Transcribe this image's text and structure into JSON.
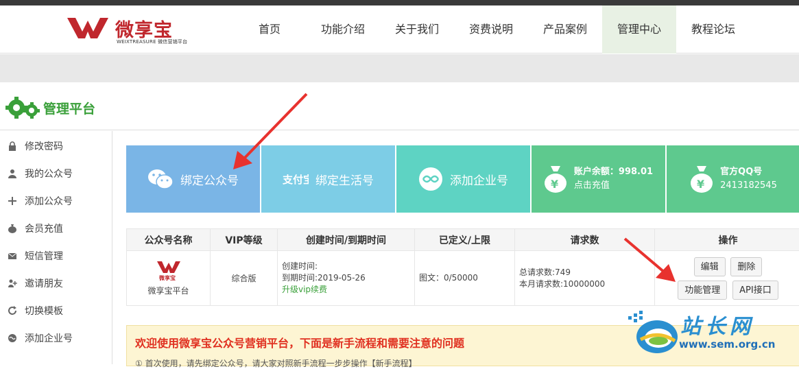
{
  "header": {
    "logo_text": "微享宝",
    "logo_sub": "WEIXTREASURE 微信营销平台",
    "nav": [
      "首页",
      "功能介绍",
      "关于我们",
      "资费说明",
      "产品案例",
      "管理中心",
      "教程论坛"
    ],
    "active_nav": "管理中心"
  },
  "platform": {
    "title": "管理平台"
  },
  "sidebar": {
    "items": [
      {
        "label": "修改密码",
        "icon": "lock-icon"
      },
      {
        "label": "我的公众号",
        "icon": "user-icon"
      },
      {
        "label": "添加公众号",
        "icon": "plus-icon"
      },
      {
        "label": "会员充值",
        "icon": "money-bag-icon"
      },
      {
        "label": "短信管理",
        "icon": "envelope-icon"
      },
      {
        "label": "邀请朋友",
        "icon": "invite-icon"
      },
      {
        "label": "切换模板",
        "icon": "refresh-icon"
      },
      {
        "label": "添加企业号",
        "icon": "enterprise-icon"
      }
    ]
  },
  "cards": {
    "bind_wechat": "绑定公众号",
    "bind_life": "绑定生活号",
    "add_enterprise": "添加企业号",
    "balance_label": "账户余额：998.01",
    "recharge": "点击充值",
    "qq_label": "官方QQ号",
    "qq_number": "2413182545",
    "colors": {
      "wechat": "#7ab5e6",
      "life": "#7dcde6",
      "enterprise": "#5ed3c3",
      "account": "#5ec98e"
    }
  },
  "table": {
    "headers": [
      "公众号名称",
      "VIP等级",
      "创建时间/到期时间",
      "已定义/上限",
      "请求数",
      "操作"
    ],
    "row": {
      "name": "微享宝平台",
      "logo_text": "微享宝",
      "vip": "综合版",
      "created": "创建时间:",
      "expires": "到期时间:2019-05-26",
      "upgrade": "升级vip续费",
      "defined": "图文：0/50000",
      "total_requests": "总请求数:749",
      "month_requests": "本月请求数:10000000",
      "buttons": {
        "edit": "编辑",
        "delete": "删除",
        "features": "功能管理",
        "api": "API接口"
      }
    }
  },
  "notice": {
    "title": "欢迎使用微享宝公众号营销平台，下面是新手流程和需要注意的问题",
    "line1": "① 首次使用，请先绑定公众号，请大家对照新手流程一步步操作【新手流程】"
  },
  "watermark": {
    "cn": "站长网",
    "url": "www.sem.org.cn"
  },
  "accent_colors": {
    "brand_red": "#c0272d",
    "green": "#3aa03a",
    "arrow_red": "#e8322e"
  }
}
